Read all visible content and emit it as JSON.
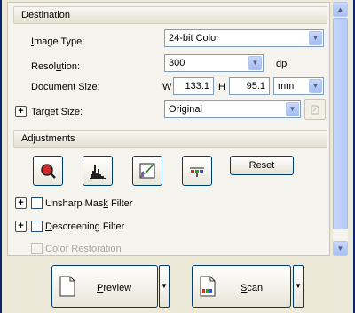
{
  "destination": {
    "header": "Destination",
    "image_type": {
      "label_prefix": "",
      "label_underlined": "I",
      "label_rest": "mage Type:",
      "value": "24-bit Color"
    },
    "resolution": {
      "label_pre": "Resol",
      "label_underlined": "u",
      "label_rest": "tion:",
      "value": "300",
      "unit": "dpi"
    },
    "document_size": {
      "label": "Document Size:",
      "w_label": "W",
      "w_value": "133.1",
      "h_label": "H",
      "h_value": "95.1",
      "unit": "mm"
    },
    "target_size": {
      "label_pre": "Target Si",
      "label_underlined": "z",
      "label_rest": "e:",
      "value": "Original"
    }
  },
  "adjustments": {
    "header": "Adjustments",
    "reset_label": "Reset",
    "unsharp": {
      "label_pre": "Unsharp Mas",
      "label_underlined": "k",
      "label_rest": " Filter",
      "checked": false
    },
    "descreening": {
      "label_pre": "",
      "label_underlined": "D",
      "label_rest": "escreening Filter",
      "checked": false
    },
    "color_restoration": {
      "label": "Color Restoration",
      "enabled": false
    }
  },
  "actions": {
    "preview": {
      "label_underlined": "P",
      "label_rest": "review"
    },
    "scan": {
      "label_underlined": "S",
      "label_rest": "can"
    }
  },
  "icons": {
    "auto_exposure": "auto-exposure-icon",
    "histogram": "histogram-icon",
    "tone_curve": "tone-curve-icon",
    "color_palette": "color-palette-icon"
  }
}
